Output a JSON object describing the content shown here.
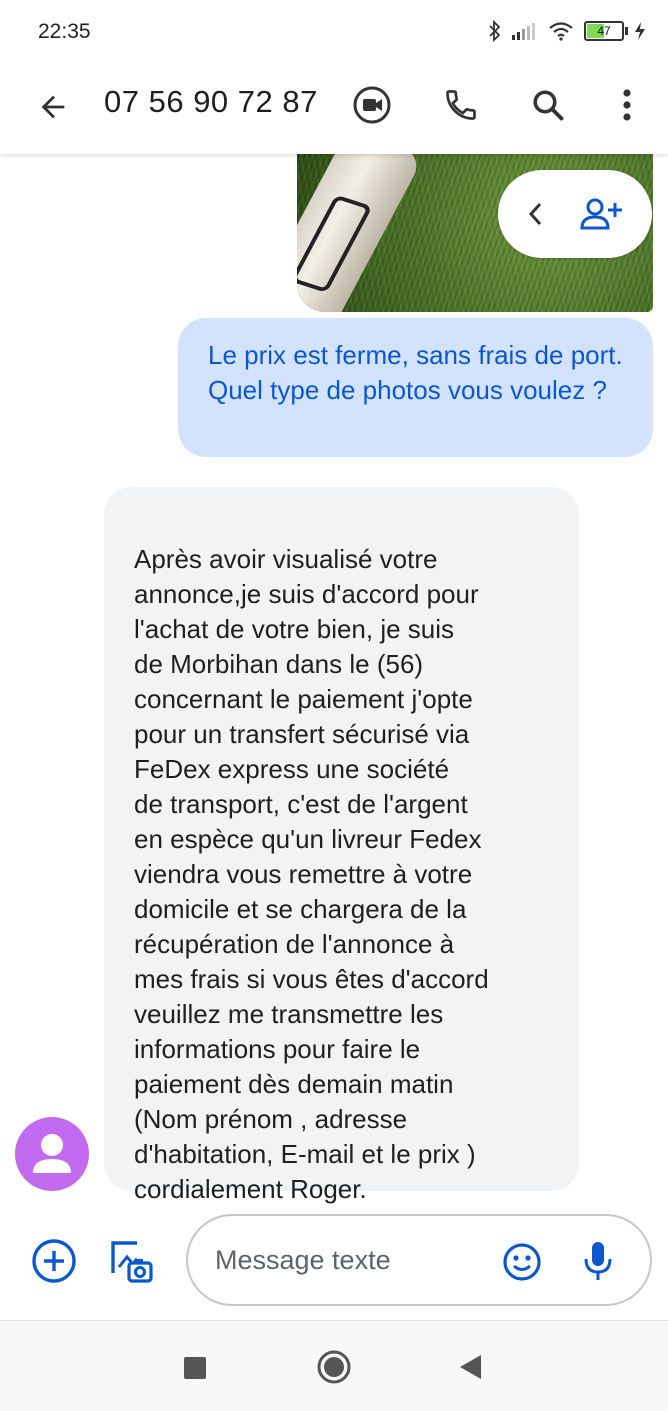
{
  "status_bar": {
    "time": "22:35",
    "battery_level": "47",
    "icons": [
      "bluetooth-icon",
      "signal-icon",
      "wifi-icon",
      "battery-icon",
      "charging-icon"
    ]
  },
  "app_bar": {
    "title": "07 56 90 72 87",
    "icons": [
      "back-arrow-icon",
      "video-call-icon",
      "phone-icon",
      "search-icon",
      "more-vert-icon"
    ]
  },
  "conversation": {
    "messages": [
      {
        "direction": "outgoing",
        "text": "Le prix est ferme, sans frais de port. Quel type de photos vous voulez ?"
      },
      {
        "direction": "incoming",
        "text": "Après avoir visualisé votre\nannonce,je suis d'accord pour\nl'achat de votre bien, je suis\nde Morbihan dans le (56)\nconcernant le paiement j'opte\npour un transfert sécurisé via\nFeDex express une société\nde transport, c'est de l'argent\nen espèce qu'un livreur Fedex\nviendra vous remettre à votre\ndomicile et se chargera de la\nrécupération de l'annonce à\nmes frais si vous êtes d'accord\nveuillez me transmettre les\ninformations pour faire le\npaiement dès demain matin\n(Nom prénom , adresse\nd'habitation, E-mail et le prix )\ncordialement Roger."
      }
    ]
  },
  "compose": {
    "placeholder": "Message texte",
    "icons": [
      "add-circle-icon",
      "gallery-icon",
      "emoji-icon",
      "microphone-icon"
    ]
  },
  "colors": {
    "accent": "#0b57d0",
    "outgoing_bubble": "#d3e3fd",
    "incoming_bubble": "#f1f3f4",
    "avatar": "#c26bf0"
  }
}
